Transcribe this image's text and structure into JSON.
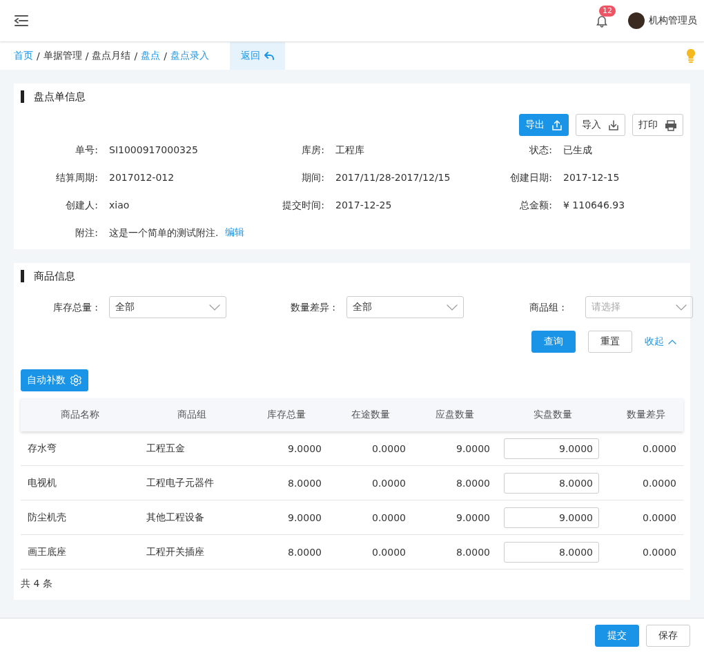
{
  "header": {
    "notifications": "12",
    "user": "机构管理员"
  },
  "breadcrumb": [
    {
      "kind": "link",
      "label": "首页"
    },
    {
      "kind": "sep",
      "label": "/"
    },
    {
      "kind": "text",
      "label": "单据管理"
    },
    {
      "kind": "sep",
      "label": "/"
    },
    {
      "kind": "text",
      "label": "盘点月结"
    },
    {
      "kind": "sep",
      "label": "/"
    },
    {
      "kind": "link",
      "label": "盘点"
    },
    {
      "kind": "sep",
      "label": "/"
    },
    {
      "kind": "link",
      "label": "盘点录入"
    }
  ],
  "back_button": "返回",
  "order_card": {
    "title": "盘点单信息",
    "actions": [
      {
        "label": "导出",
        "kind": "export",
        "primary": true
      },
      {
        "label": "导入",
        "kind": "import",
        "primary": false
      },
      {
        "label": "打印",
        "kind": "print",
        "primary": false
      }
    ],
    "fields": [
      {
        "label": "单号:",
        "value": "SI1000917000325"
      },
      {
        "label": "库房:",
        "value": "工程库"
      },
      {
        "label": "状态:",
        "value": "已生成"
      },
      {
        "label": "结算周期:",
        "value": "2017012-012"
      },
      {
        "label": "期间:",
        "value": "2017/11/28-2017/12/15"
      },
      {
        "label": "创建日期:",
        "value": "2017-12-15"
      },
      {
        "label": "创建人:",
        "value": "xiao"
      },
      {
        "label": "提交时间:",
        "value": "2017-12-25"
      },
      {
        "label": "总金额:",
        "value": "¥ 110646.93"
      }
    ],
    "note": {
      "label": "附注:",
      "value": "这是一个简单的测试附注.",
      "link": "编辑"
    }
  },
  "goods_card": {
    "title": "商品信息",
    "filters": [
      {
        "label": "库存总量 :",
        "value": "全部"
      },
      {
        "label": "数量差异 :",
        "value": "全部"
      },
      {
        "label": "商品组 :",
        "placeholder": "请选择"
      }
    ],
    "query_button": "查询",
    "reset_button": "重置",
    "collapse_link": "收起",
    "auto_fill_button": "自动补数",
    "table": {
      "columns": [
        "商品名称",
        "商品组",
        "库存总量",
        "在途数量",
        "应盘数量",
        "实盘数量",
        "数量差异"
      ],
      "rows": [
        [
          "存水弯",
          "工程五金",
          "9.0000",
          "0.0000",
          "9.0000",
          "9.0000",
          "0.0000"
        ],
        [
          "电视机",
          "工程电子元器件",
          "8.0000",
          "0.0000",
          "8.0000",
          "8.0000",
          "0.0000"
        ],
        [
          "防尘机壳",
          "其他工程设备",
          "9.0000",
          "0.0000",
          "9.0000",
          "9.0000",
          "0.0000"
        ],
        [
          "画王底座",
          "工程开关插座",
          "8.0000",
          "0.0000",
          "8.0000",
          "8.0000",
          "0.0000"
        ]
      ]
    },
    "total": "共 4 条"
  },
  "footer": {
    "submit_button": "提交",
    "save_button": "保存"
  }
}
